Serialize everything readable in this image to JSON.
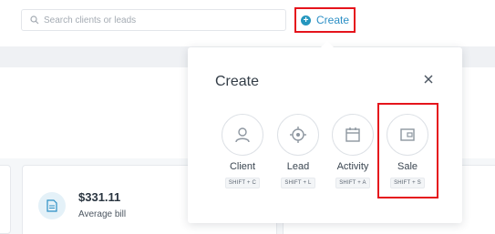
{
  "search": {
    "placeholder": "Search clients or leads",
    "value": ""
  },
  "header": {
    "create_label": "Create"
  },
  "summary": {
    "amount": "$331.11",
    "label": "Average bill"
  },
  "popover": {
    "title": "Create",
    "options": [
      {
        "label": "Client",
        "shortcut": "SHIFT + C",
        "icon": "person-icon"
      },
      {
        "label": "Lead",
        "shortcut": "SHIFT + L",
        "icon": "target-icon"
      },
      {
        "label": "Activity",
        "shortcut": "SHIFT + A",
        "icon": "calendar-icon"
      },
      {
        "label": "Sale",
        "shortcut": "SHIFT + S",
        "icon": "wallet-icon"
      }
    ]
  },
  "colors": {
    "accent": "#2c8fc5",
    "highlight": "#e5141c",
    "icon": "#8d96a0"
  }
}
